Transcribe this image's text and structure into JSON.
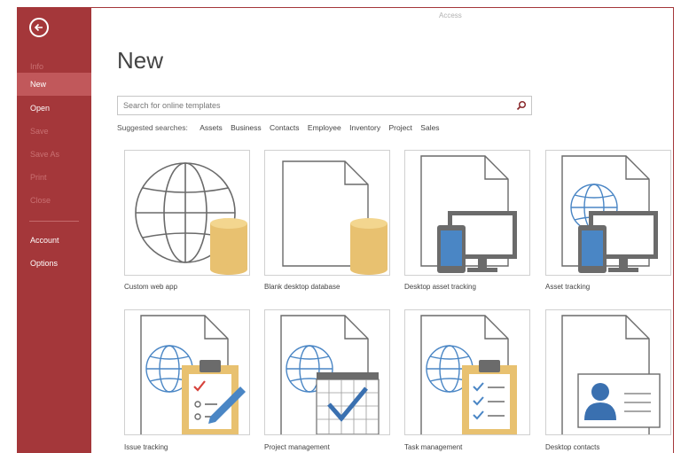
{
  "window": {
    "title": "Access"
  },
  "sidebar": {
    "items": [
      {
        "label": "Info"
      },
      {
        "label": "New"
      },
      {
        "label": "Open"
      },
      {
        "label": "Save"
      },
      {
        "label": "Save As"
      },
      {
        "label": "Print"
      },
      {
        "label": "Close"
      },
      {
        "label": "Account"
      },
      {
        "label": "Options"
      }
    ],
    "active": "New"
  },
  "main": {
    "title": "New",
    "search": {
      "placeholder": "Search for online templates"
    },
    "suggested": {
      "label": "Suggested searches:",
      "items": [
        "Assets",
        "Business",
        "Contacts",
        "Employee",
        "Inventory",
        "Project",
        "Sales"
      ]
    },
    "templates": [
      {
        "label": "Custom web app"
      },
      {
        "label": "Blank desktop database"
      },
      {
        "label": "Desktop asset tracking"
      },
      {
        "label": "Asset tracking"
      },
      {
        "label": "Issue tracking"
      },
      {
        "label": "Project management"
      },
      {
        "label": "Task management"
      },
      {
        "label": "Desktop contacts"
      }
    ]
  },
  "colors": {
    "accent": "#a4373a",
    "active_item": "#c1585b",
    "db_gold": "#e8c170",
    "device_blue": "#4a86c5"
  }
}
